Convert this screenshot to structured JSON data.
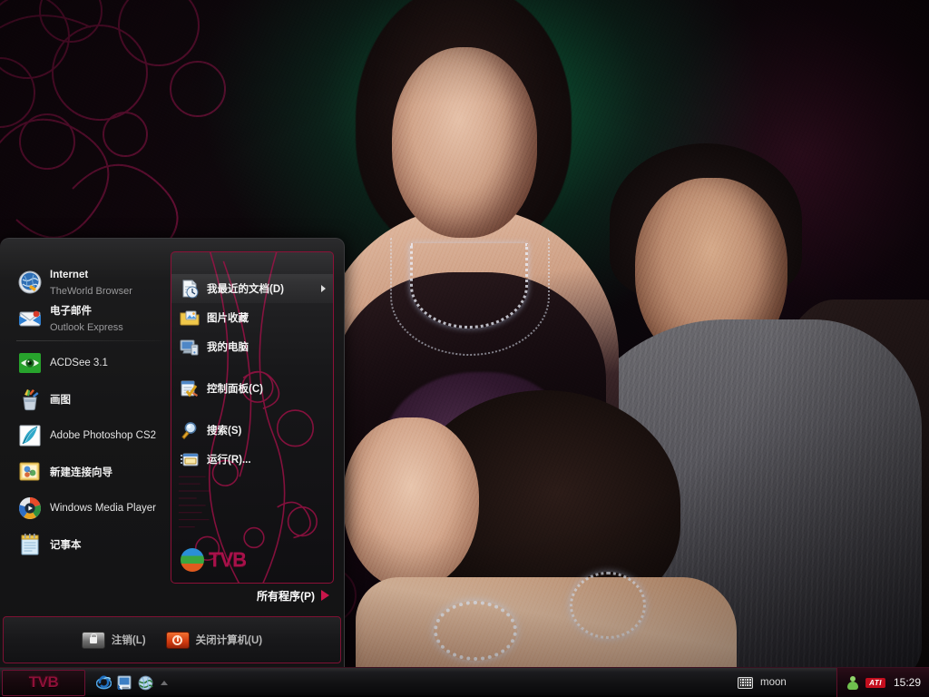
{
  "desktop": {
    "wallpaper_alt": "TVB drama promotional photo - three people on dark green and magenta background",
    "accent_crimson": "#8d1138",
    "accent_pink": "#c9164b",
    "panel_dark": "#161617"
  },
  "start_menu": {
    "left_items": [
      {
        "title": "Internet",
        "subtitle": "TheWorld Browser",
        "icon": "internet-globe-icon"
      },
      {
        "title": "电子邮件",
        "subtitle": "Outlook Express",
        "icon": "email-envelope-icon"
      },
      {
        "title": "ACDSee 3.1",
        "subtitle": "",
        "icon": "acdsee-eye-icon"
      },
      {
        "title": "画图",
        "subtitle": "",
        "icon": "paint-brushes-icon"
      },
      {
        "title": "Adobe Photoshop CS2",
        "subtitle": "",
        "icon": "photoshop-feather-icon"
      },
      {
        "title": "新建连接向导",
        "subtitle": "",
        "icon": "new-connection-wizard-icon"
      },
      {
        "title": "Windows Media Player",
        "subtitle": "",
        "icon": "media-player-icon"
      },
      {
        "title": "记事本",
        "subtitle": "",
        "icon": "notepad-icon"
      }
    ],
    "all_programs_label": "所有程序(P)",
    "right_items": [
      {
        "label": "我最近的文档(D)",
        "icon": "recent-documents-icon",
        "has_submenu": true,
        "selected": true
      },
      {
        "label": "图片收藏",
        "icon": "my-pictures-folder-icon",
        "has_submenu": false,
        "selected": false
      },
      {
        "label": "我的电脑",
        "icon": "my-computer-icon",
        "has_submenu": false,
        "selected": false
      },
      {
        "label": "控制面板(C)",
        "icon": "control-panel-icon",
        "has_submenu": false,
        "selected": false
      },
      {
        "label": "搜索(S)",
        "icon": "search-magnifier-icon",
        "has_submenu": false,
        "selected": false
      },
      {
        "label": "运行(R)...",
        "icon": "run-dialog-icon",
        "has_submenu": false,
        "selected": false
      }
    ],
    "brand": {
      "word": "TVB",
      "logo": "tvb-circle-logo"
    },
    "logoff_label": "注销(L)",
    "logoff_icon": "lock-icon",
    "shutdown_label": "关闭计算机(U)",
    "shutdown_icon": "power-icon"
  },
  "taskbar": {
    "start_label": "TVB",
    "quick_launch": [
      {
        "name": "internet-explorer-icon"
      },
      {
        "name": "show-desktop-shortcut-icon"
      },
      {
        "name": "globe-browser-icon"
      }
    ],
    "quick_launch_overflow_icon": "chevron-up-icon",
    "tasks": [
      {
        "label": "moon",
        "icon": "keyboard-icon"
      }
    ],
    "tray": {
      "user_icon": "user-account-icon",
      "ati_label": "ATI",
      "clock": "15:29"
    }
  }
}
